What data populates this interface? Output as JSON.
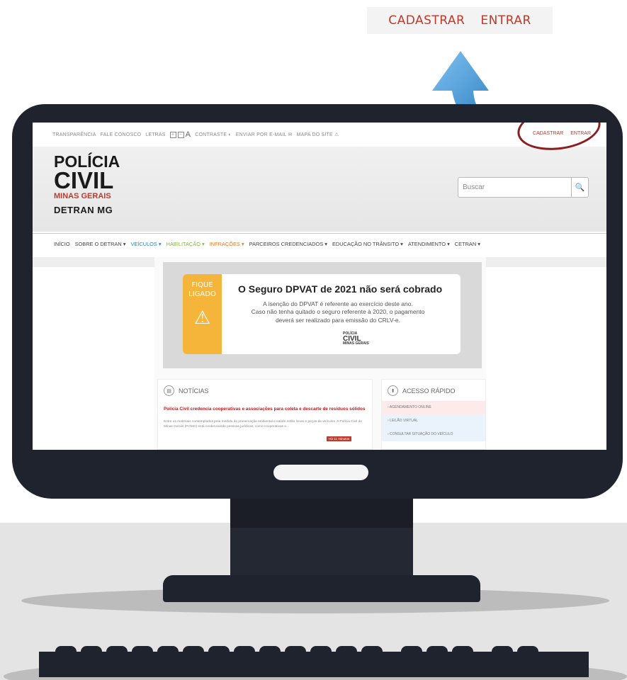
{
  "callout": {
    "cadastrar": "CADASTRAR",
    "entrar": "ENTRAR"
  },
  "topbar": {
    "transparencia": "TRANSPARÊNCIA",
    "fale_conosco": "FALE CONOSCO",
    "letras": "LETRAS",
    "plus": "+",
    "minus": "−",
    "big_a": "A",
    "contraste": "CONTRASTE ◐",
    "enviar_email": "ENVIAR POR E-MAIL ✉",
    "mapa_site": "MAPA DO SITE ⚠",
    "cadastrar": "CADASTRAR",
    "entrar": "ENTRAR"
  },
  "logo": {
    "line1": "POLÍCIA",
    "line2": "CIVIL",
    "line3": "MINAS GERAIS",
    "line4": "DETRAN MG"
  },
  "search": {
    "placeholder": "Buscar",
    "icon": "search-icon",
    "glyph": "🔍"
  },
  "nav": {
    "items": [
      "INÍCIO",
      "SOBRE O DETRAN ▾",
      "VEÍCULOS ▾",
      "HABILITAÇÃO ▾",
      "INFRAÇÕES ▾",
      "PARCEIROS CREDENCIADOS ▾",
      "EDUCAÇÃO NO TRÂNSITO ▾",
      "ATENDIMENTO ▾",
      "CETRAN ▾"
    ]
  },
  "banner": {
    "badge_line1": "FIQUE",
    "badge_line2": "LIGADO",
    "badge_icon": "⚠",
    "title": "O Seguro DPVAT de 2021 não será cobrado",
    "text1": "A isenção do DPVAT é referente ao exercício deste ano.",
    "text2": "Caso não tenha quitado o seguro referente à 2020, o pagamento",
    "text3": "deverá ser realizado para emissão do CRLV-e.",
    "logo_top": "POLÍCIA",
    "logo_main": "CIVIL",
    "logo_sub": "MINAS GERAIS"
  },
  "news": {
    "heading": "NOTÍCIAS",
    "title": "Polícia Civil credencia cooperativas e associações para coleta e descarte de resíduos sólidos",
    "body": "Entre os materiais contemplados pela medida de preservação ambiental e saúde estão lonas e peças de veículos. A Polícia Civil de Minas Gerais (PCMG) está credenciando pessoas jurídicas, como cooperativas e...",
    "tag": "Há 11 minutos"
  },
  "quick": {
    "heading": "ACESSO RÁPIDO",
    "items": [
      "› AGENDAMENTO ONLINE",
      "› LEILÃO VIRTUAL",
      "› CONSULTAR SITUAÇÃO DO VEÍCULO"
    ]
  }
}
